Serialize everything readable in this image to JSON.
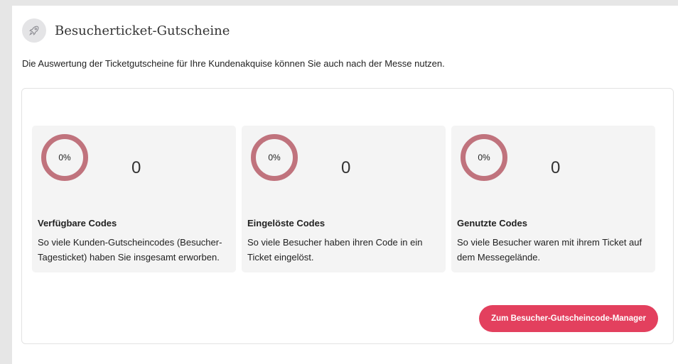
{
  "header": {
    "title": "Besucherticket-Gutscheine",
    "icon": "rocket-icon"
  },
  "intro": "Die Auswertung der Ticketgutscheine für Ihre Kundenakquise können Sie auch nach der Messe nutzen.",
  "stats": [
    {
      "percent_label": "0%",
      "percent_value": 0,
      "count": "0",
      "title": "Verfügbare Codes",
      "description": "So viele Kunden-Gutscheincodes (Besucher-Tagesticket) haben Sie insgesamt erworben."
    },
    {
      "percent_label": "0%",
      "percent_value": 0,
      "count": "0",
      "title": "Eingelöste Codes",
      "description": "So viele Besucher haben ihren Code in ein Ticket eingelöst."
    },
    {
      "percent_label": "0%",
      "percent_value": 0,
      "count": "0",
      "title": "Genutzte Codes",
      "description": "So viele Besucher waren mit ihrem Ticket auf dem Messegelände."
    }
  ],
  "cta_label": "Zum Besucher-Gutscheincode-Manager",
  "colors": {
    "ring": "#c0737d",
    "cta": "#e3405e",
    "background": "#e6e6e6"
  }
}
